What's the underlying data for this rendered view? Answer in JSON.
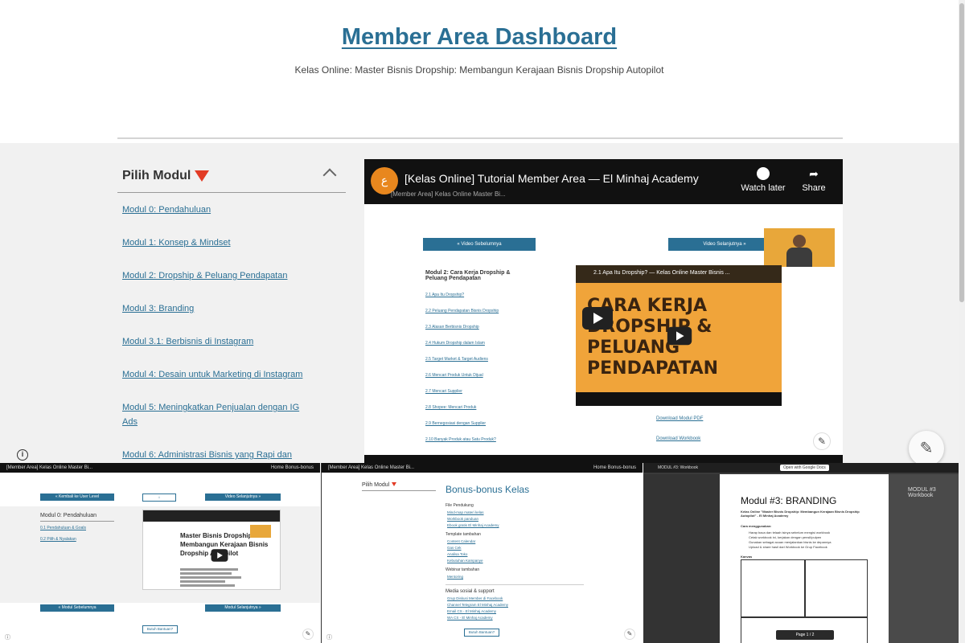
{
  "header": {
    "title": "Member Area Dashboard",
    "subtitle": "Kelas Online: Master Bisnis Dropship: Membangun Kerajaan Bisnis Dropship Autopilot"
  },
  "sidebar": {
    "heading": "Pilih Modul",
    "items": [
      {
        "label": "Modul 0: Pendahuluan"
      },
      {
        "label": "Modul 1: Konsep & Mindset"
      },
      {
        "label": "Modul 2: Dropship & Peluang Pendapatan"
      },
      {
        "label": "Modul 3: Branding"
      },
      {
        "label": "Modul 3.1: Berbisnis di Instagram"
      },
      {
        "label": "Modul 4: Desain untuk Marketing di Instagram"
      },
      {
        "label": "Modul 5: Meningkatkan Penjualan dengan IG Ads"
      },
      {
        "label": "Modul 6: Administrasi Bisnis yang Rapi dan"
      }
    ]
  },
  "video": {
    "title": "[Kelas Online] Tutorial Member Area — El Minhaj Academy",
    "subtitle": "[Member Area] Kelas Online Master Bi...",
    "watch_later": "Watch later",
    "share": "Share",
    "prev_btn": "« Video Sebelumnya",
    "next_btn": "Video Selanjutnya »",
    "inner_module_title": "Modul 2: Cara Kerja Dropship & Peluang Pendapatan",
    "inner_items": [
      "2.1 Apa Itu Dropship?",
      "2.2 Peluang Pendapatan Bisnis Dropship",
      "2.3 Alasan Berbisnis Dropship",
      "2.4 Hukum Dropship dalam Islam",
      "2.5 Target Market & Target Audiens",
      "2.6 Mencari Produk Untuk Dijual",
      "2.7 Mencari Supplier",
      "2.8 Shopee: Mencari Produk",
      "2.9 Bernegosiasi dengan Supplier",
      "2.10 Banyak Produk atau Satu Produk?"
    ],
    "inner_video_title": "2.1 Apa Itu Dropship? — Kelas Online Master Bisnis ...",
    "inner_big_text": "CARA KERJA DROPSHIP & PELUANG PENDAPATAN",
    "download_modul": "Download Modul PDF",
    "download_workbook": "Download Workbook"
  },
  "thumb1": {
    "bar": "[Member Area] Kelas Online Master Bi...",
    "bar_right": "Home    Bonus-bonus",
    "prev_btn": "« Kembali ke User Level",
    "next_btn": "Video Selanjutnya »",
    "module": "Modul 0: Pendahuluan",
    "links": [
      "0.1 Pendahuluan & Goals",
      "0.2 Pilih & Nyalakan"
    ],
    "video_title": "Master Bisnis Dropship: Membangun Kerajaan Bisnis Dropship Autopilot",
    "bottom_prev": "« Modul Sebelumnya",
    "bottom_next": "Modul Selanjutnya »",
    "outline_btn": "Butuh Bantuan?"
  },
  "thumb2": {
    "bar": "[Member Area] Kelas Online Master Bi...",
    "bar_right": "Home    Bonus-bonus",
    "module": "Pilih Modul",
    "title": "Bonus-bonus Kelas",
    "section1": "File Pendukung",
    "section1_items": [
      "Mind-map materi kelas",
      "Workbook panduan",
      "Ebook gratis El Minhaj Academy"
    ],
    "section2": "Template tambahan",
    "section2_items": [
      "Content Calendar",
      "Gas Cek",
      "Analisa Toko",
      "Kebutuhan Kampanye"
    ],
    "section3": "Webinar tambahan",
    "section3_items": [
      "Mentoring"
    ],
    "media": "Media sosial & support",
    "media_items": [
      "Grup Diskusi Member di Facebook",
      "Channel Telegram El Minhaj Academy",
      "Email CS - El Minhaj Academy",
      "WA CS - El Minhaj Academy"
    ],
    "outline_btn": "Butuh Bantuan?"
  },
  "thumb3": {
    "bar_title": "MODUL #3: Workbook",
    "open_with": "Open with Google Docs",
    "doc_title": "Modul #3: BRANDING",
    "doc_sub": "Kelas Online \"Master Bisnis Dropship: Membangun Kerajaan Bisnis Dropship Autopilot\" - El Minhaj Academy",
    "cara": "Cara menggunakan:",
    "steps": [
      "Harap baca dan telaah isinya sebelum mengisi workbook",
      "Cetak workbook ini, kerjakan dengan pensil/pulpen",
      "Gunakan sebagai acuan menjalankan bisnis ke depannya",
      "Upload & share hasil dari Workbook ke Grup Facebook"
    ],
    "section": "Kanvas",
    "side_title": "MODUL #3 Workbook",
    "page_label": "Page  1  /  2"
  },
  "icons": {
    "info": "info-icon",
    "pencil": "pencil-icon",
    "chevron": "chevron-up-icon"
  },
  "colors": {
    "accent": "#2a6f94",
    "red": "#e23b25",
    "orange": "#f0a43a"
  }
}
